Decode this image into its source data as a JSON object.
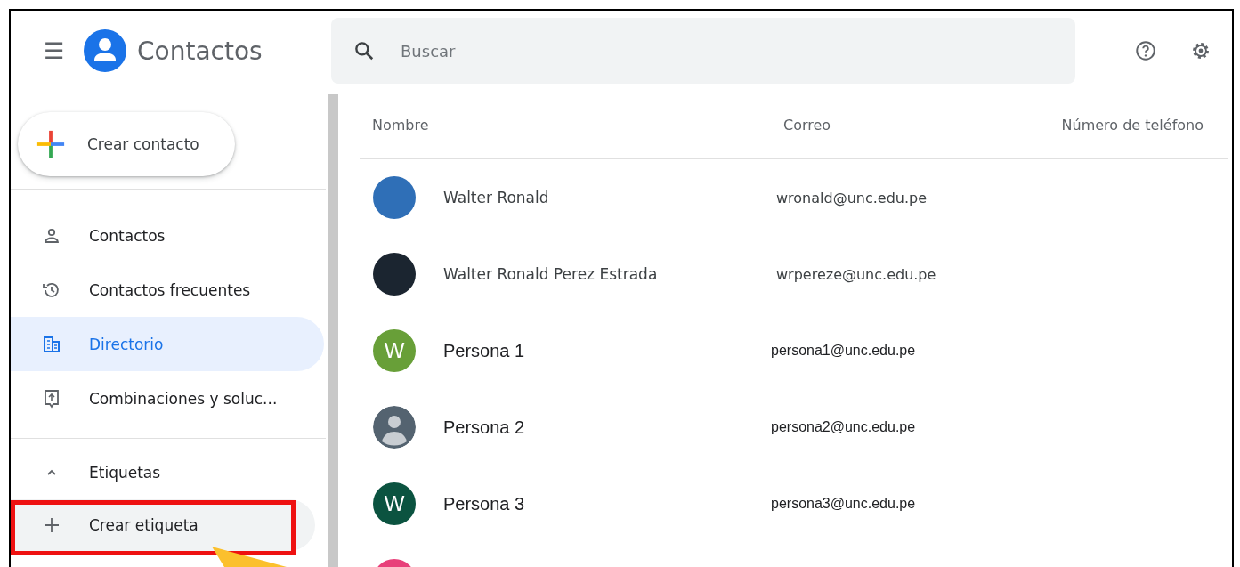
{
  "header": {
    "menu_icon": "☰",
    "app_name": "Contactos",
    "search": {
      "placeholder": "Buscar"
    }
  },
  "sidebar": {
    "create_button": "Crear contacto",
    "items": [
      {
        "label": "Contactos",
        "selected": false
      },
      {
        "label": "Contactos frecuentes",
        "selected": false
      },
      {
        "label": "Directorio",
        "selected": true
      },
      {
        "label": "Combinaciones y soluc...",
        "selected": false
      }
    ],
    "labels_section": {
      "title": "Etiquetas",
      "expanded": true,
      "create_label": "Crear etiqueta"
    }
  },
  "table": {
    "columns": [
      "Nombre",
      "Correo",
      "Número de teléfono"
    ],
    "rows": [
      {
        "avatar": {
          "kind": "photo",
          "color": "#2f6fb7"
        },
        "name": "Walter Ronald",
        "email": "wronald@unc.edu.pe"
      },
      {
        "avatar": {
          "kind": "photo",
          "color": "#1b2530"
        },
        "name": "Walter Ronald Perez Estrada",
        "email": "wrpereze@unc.edu.pe"
      },
      {
        "avatar": {
          "kind": "letter",
          "letter": "W",
          "color": "#689f38"
        },
        "name": "Persona 1",
        "email": "persona1@unc.edu.pe"
      },
      {
        "avatar": {
          "kind": "default",
          "color": "#546370"
        },
        "name": "Persona 2",
        "email": "persona2@unc.edu.pe"
      },
      {
        "avatar": {
          "kind": "letter",
          "letter": "W",
          "color": "#0b5340"
        },
        "name": "Persona 3",
        "email": "persona3@unc.edu.pe"
      },
      {
        "avatar": {
          "kind": "blank",
          "color": "#e8407a"
        }
      }
    ]
  }
}
